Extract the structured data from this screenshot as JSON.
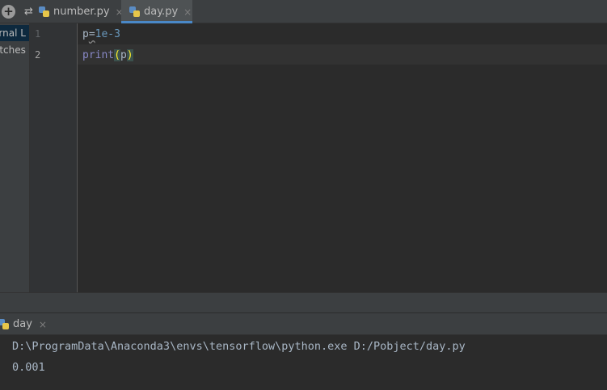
{
  "tabs": [
    {
      "label": "number.py",
      "active": false
    },
    {
      "label": "day.py",
      "active": true
    }
  ],
  "tab_close_glyph": "×",
  "project_panel": {
    "items": [
      "ernal L",
      "atches"
    ]
  },
  "editor": {
    "line_numbers": [
      "1",
      "2"
    ],
    "line1": {
      "var": "p",
      "op": "=",
      "value": "1e-3"
    },
    "line2": {
      "func": "print",
      "open": "(",
      "arg": "p",
      "close": ")"
    }
  },
  "run_panel": {
    "tab_label": "day",
    "command": "D:\\ProgramData\\Anaconda3\\envs\\tensorflow\\python.exe D:/Pobject/day.py",
    "output": "0.001"
  },
  "icons": {
    "add": "add-circle-icon",
    "split": "split-icon",
    "python_file": "python-file-icon",
    "close": "close-icon"
  },
  "colors": {
    "editor_bg": "#2b2b2b",
    "panel_bg": "#3c3f41",
    "accent": "#4a88c7",
    "number": "#6897bb",
    "builtin": "#8888c6",
    "brace_match": "#ffef28"
  }
}
